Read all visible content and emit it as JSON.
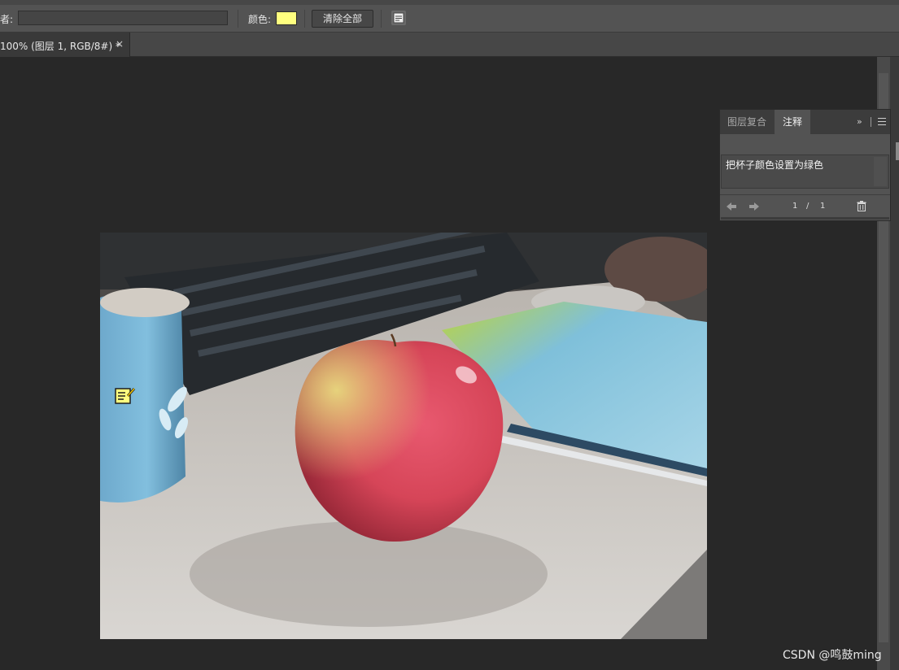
{
  "options_bar": {
    "author_label": "者:",
    "author_value": "",
    "color_label": "颜色:",
    "note_color": "#ffff7f",
    "clear_all_label": "清除全部",
    "note_tool_icon": "note-icon"
  },
  "document": {
    "tab_label": "100% (图层 1, RGB/8#) *",
    "close_label": "×"
  },
  "notes_panel": {
    "tabs": [
      "图层复合",
      "注释"
    ],
    "active_tab": "注释",
    "expand_label": "»",
    "note_text": "把杯子颜色设置为绿色",
    "page_current": "1",
    "page_separator": "/",
    "page_total": "1"
  },
  "watermark": "CSDN @鸣鼓ming"
}
